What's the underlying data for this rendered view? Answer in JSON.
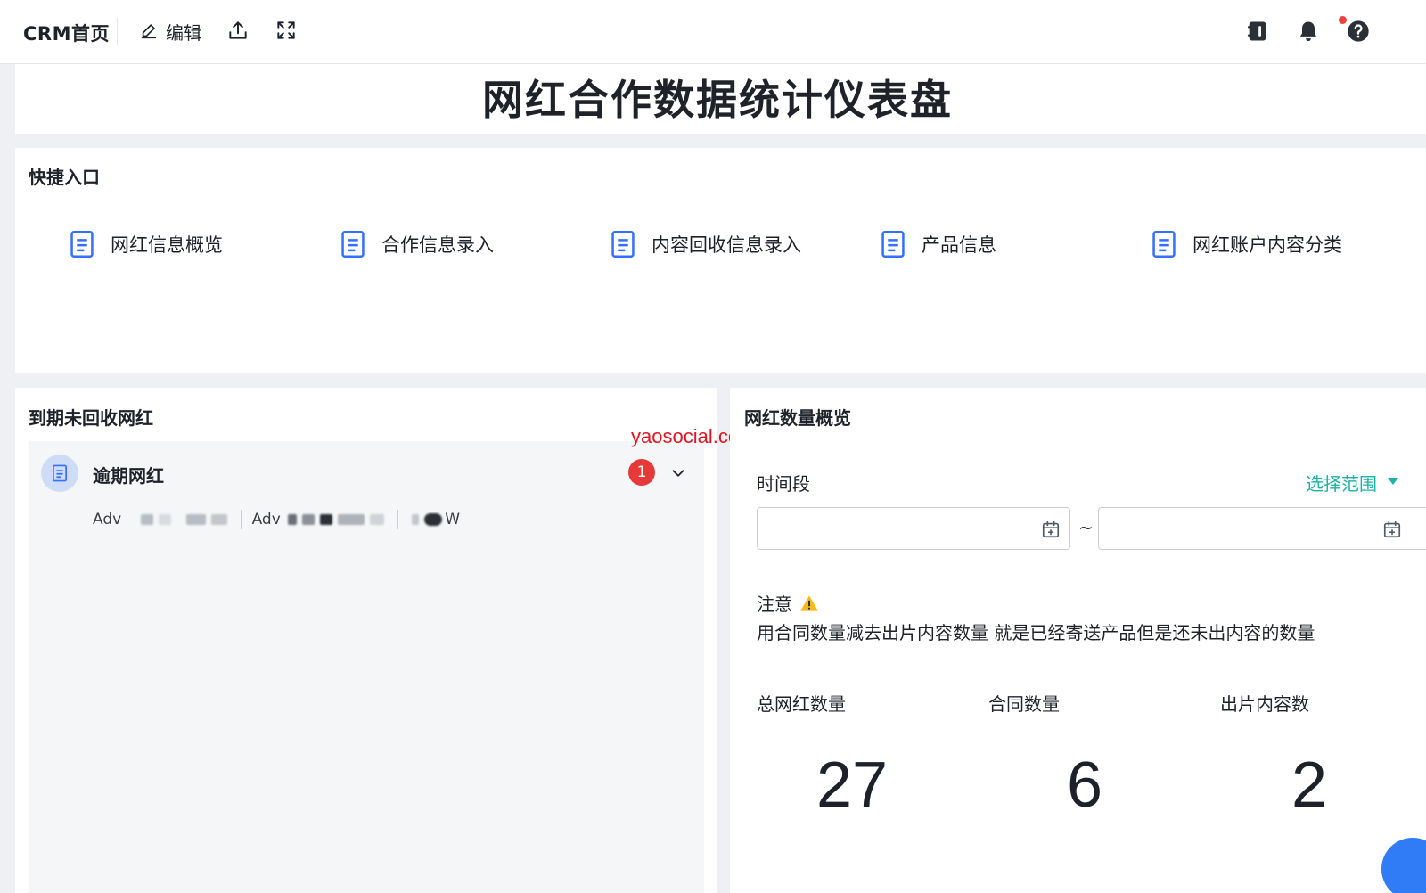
{
  "topbar": {
    "brand": "CRM首页",
    "edit_label": "编辑",
    "icons": [
      "edit-icon",
      "share-icon",
      "fullscreen-icon",
      "notebook-icon",
      "bell-icon",
      "help-icon"
    ]
  },
  "page": {
    "title": "网红合作数据统计仪表盘"
  },
  "quick": {
    "title": "快捷入口",
    "items": [
      {
        "label": "网红信息概览",
        "icon": "document-icon"
      },
      {
        "label": "合作信息录入",
        "icon": "document-icon"
      },
      {
        "label": "内容回收信息录入",
        "icon": "document-icon"
      },
      {
        "label": "产品信息",
        "icon": "document-icon"
      },
      {
        "label": "网红账户内容分类",
        "icon": "document-icon"
      }
    ]
  },
  "overdue": {
    "panel_title": "到期未回收网红",
    "group_title": "逾期网红",
    "count": "1",
    "tags": [
      {
        "prefix": "Adv"
      },
      {
        "prefix": "Adv"
      },
      {
        "suffix": "W"
      }
    ]
  },
  "watermark": "yaosocial.com",
  "overview": {
    "title": "网红数量概览",
    "time_label": "时间段",
    "select_range": "选择范围",
    "date_start": "",
    "date_end": "",
    "separator": "~",
    "note_title": "注意",
    "note_text": "用合同数量减去出片内容数量 就是已经寄送产品但是还未出内容的数量",
    "stats": [
      {
        "label": "总网红数量",
        "value": "27"
      },
      {
        "label": "合同数量",
        "value": "6"
      },
      {
        "label": "出片内容数",
        "value": "2"
      }
    ]
  },
  "colors": {
    "accent": "#2f7cf6",
    "teal": "#1fb1a5",
    "badge": "#e5393a",
    "watermark": "#e0161f"
  }
}
